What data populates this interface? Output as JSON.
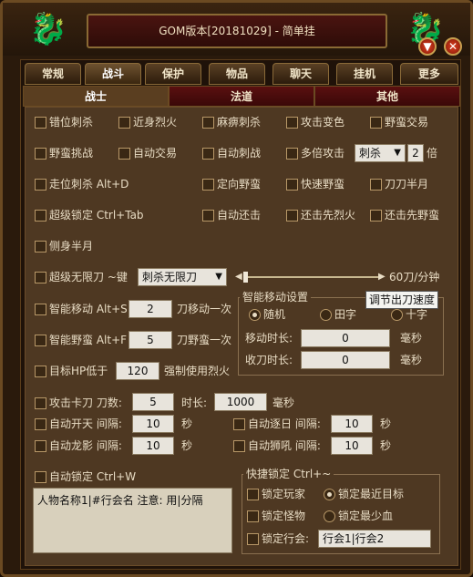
{
  "window": {
    "title": "GOM版本[20181029] - 简单挂"
  },
  "tabs": [
    "常规",
    "战斗",
    "保护",
    "物品",
    "聊天",
    "挂机",
    "更多"
  ],
  "active_tab": 1,
  "subtabs": [
    "战士",
    "法道",
    "其他"
  ],
  "options": {
    "r1": [
      "错位刺杀",
      "近身烈火",
      "麻痹刺杀",
      "攻击变色",
      "野蛮交易"
    ],
    "r2": [
      "野蛮挑战",
      "自动交易",
      "自动刺战",
      "多倍攻击"
    ],
    "multi_select": "刺杀",
    "multi_value": "2",
    "multi_unit": "倍",
    "r3": [
      "走位刺杀 Alt+D",
      "定向野蛮",
      "快速野蛮",
      "刀刀半月"
    ],
    "r4": [
      "超级锁定 Ctrl+Tab",
      "自动还击",
      "还击先烈火",
      "还击先野蛮"
    ],
    "r5": [
      "侧身半月"
    ],
    "unlimited_label": "超级无限刀 ~键",
    "unlimited_select": "刺杀无限刀",
    "speed_value": "60刀/分钟",
    "tooltip": "调节出刀速度",
    "smart_move_label": "智能移动 Alt+S",
    "smart_move_value": "2",
    "smart_move_suffix": "刀移动一次",
    "smart_barb_label": "智能野蛮 Alt+F",
    "smart_barb_value": "5",
    "smart_barb_suffix": "刀野蛮一次",
    "hp_label": "目标HP低于",
    "hp_value": "120",
    "hp_suffix": "强制使用烈火",
    "card_label": "攻击卡刀 刀数:",
    "card_value": "5",
    "card_time_label": "时长:",
    "card_time_value": "1000",
    "card_time_unit": "毫秒",
    "auto_open_label": "自动开天 间隔:",
    "auto_open_value": "10",
    "auto_chase_label": "自动逐日 间隔:",
    "auto_chase_value": "10",
    "auto_dragon_label": "自动龙影 间隔:",
    "auto_dragon_value": "10",
    "auto_lion_label": "自动狮吼 间隔:",
    "auto_lion_value": "10",
    "sec": "秒",
    "auto_lock_label": "自动锁定 Ctrl+W",
    "names_text": "人物名称1|#行会名 注意: 用|分隔"
  },
  "smart_move_group": {
    "title": "智能移动设置",
    "modes": [
      "随机",
      "田字",
      "十字"
    ],
    "move_time_label": "移动时长:",
    "move_time_value": "0",
    "retract_time_label": "收刀时长:",
    "retract_time_value": "0",
    "unit": "毫秒"
  },
  "quick_lock": {
    "title": "快捷锁定 Ctrl+~",
    "lock_player": "锁定玩家",
    "nearest": "锁定最近目标",
    "lock_monster": "锁定怪物",
    "least_hp": "锁定最少血",
    "lock_guild": "锁定行会:",
    "guild_value": "行会1|行会2"
  }
}
